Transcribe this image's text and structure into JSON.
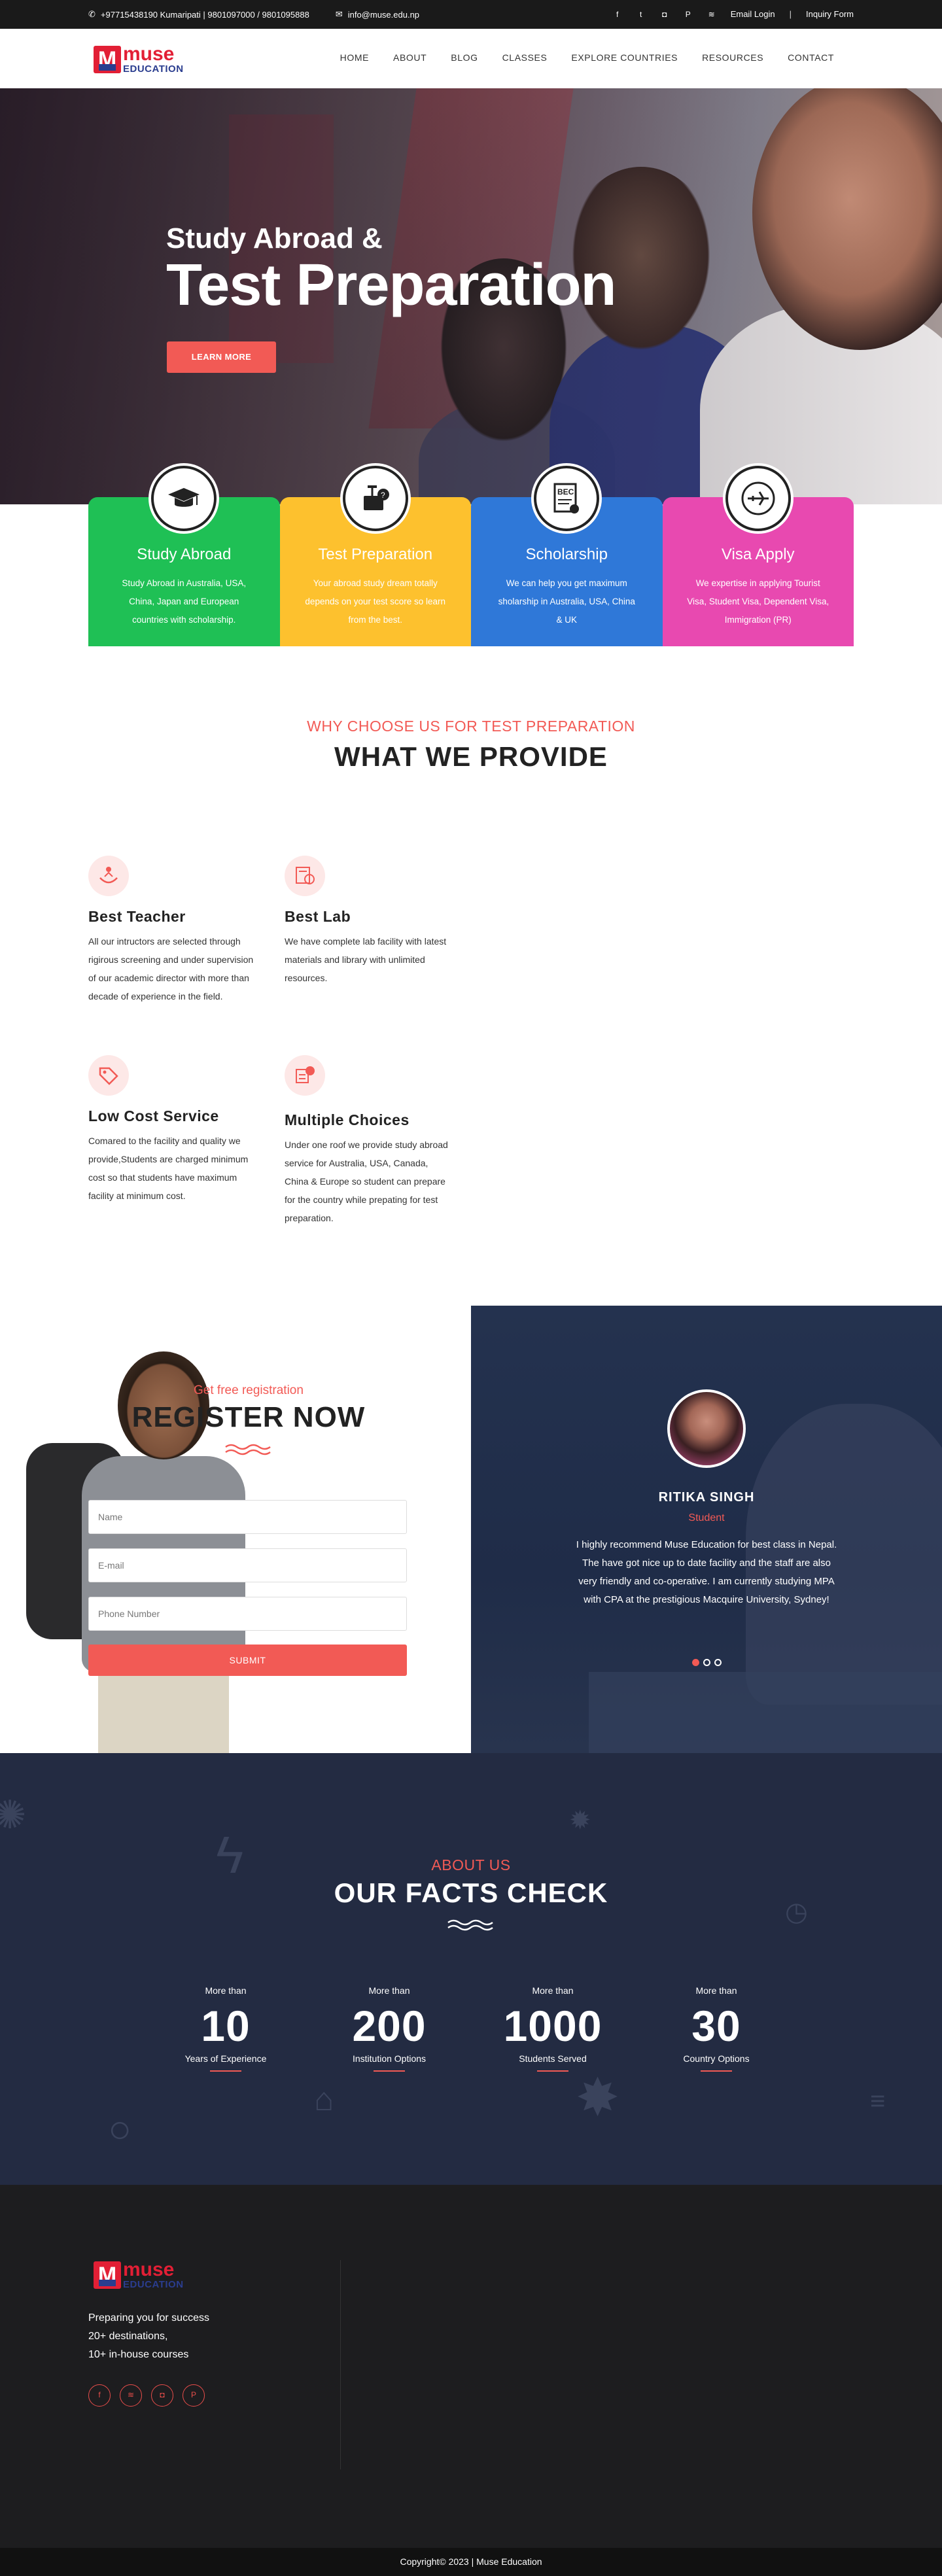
{
  "topbar": {
    "phone": "+97715438190 Kumaripati | 9801097000 / 9801095888",
    "email": "info@muse.edu.np",
    "social_icons": [
      "facebook-icon",
      "twitter-icon",
      "instagram-icon",
      "pinterest-icon",
      "rss-icon"
    ],
    "links": [
      "Email Login",
      "|",
      "Inquiry Form"
    ]
  },
  "logo": {
    "brand": "muse",
    "tagline": "EDUCATION"
  },
  "nav": [
    "HOME",
    "ABOUT",
    "BLOG",
    "CLASSES",
    "EXPLORE COUNTRIES",
    "RESOURCES",
    "CONTACT"
  ],
  "hero": {
    "line1": "Study Abroad &",
    "line2": "Test Preparation",
    "button": "LEARN MORE"
  },
  "services": [
    {
      "title": "Study Abroad",
      "text": "Study Abroad in Australia, USA, China, Japan and European countries with scholarship.",
      "color": "#1fc055",
      "icon": "graduation-cap-icon"
    },
    {
      "title": "Test Preparation",
      "text": "Your abroad study dream totally depends on your test score so learn from the best.",
      "color": "#fdc12e",
      "icon": "test-prep-icon"
    },
    {
      "title": "Scholarship",
      "text": "We can help you get maximum sholarship in Australia, USA, China & UK",
      "color": "#2f78d8",
      "icon": "certificate-icon"
    },
    {
      "title": "Visa Apply",
      "text": "We expertise in applying Tourist Visa, Student Visa, Dependent Visa, Immigration (PR)",
      "color": "#e849b0",
      "icon": "airplane-icon"
    }
  ],
  "why": {
    "subtitle": "WHY CHOOSE US FOR TEST PREPARATION",
    "title": "WHAT WE PROVIDE",
    "features": [
      {
        "title": "Best Teacher",
        "text": "All our intructors are selected through rigirous screening and under supervision of our academic director with more than decade of experience in the field.",
        "icon": "teacher-icon"
      },
      {
        "title": "Best Lab",
        "text": "We have complete lab facility with latest materials and library with unlimited resources.",
        "icon": "lab-icon"
      },
      {
        "title": "Low Cost Service",
        "text": "Comared to the facility and quality we provide,Students are charged minimum cost so that students have maximum facility at minimum cost.",
        "icon": "price-tag-icon"
      },
      {
        "title": "Multiple Choices",
        "text": "Under one roof we provide study abroad service for Australia, USA, Canada, China & Europe so student can prepare for the country while prepating for test preparation.",
        "icon": "choices-icon"
      }
    ]
  },
  "register": {
    "subtitle": "Get free registration",
    "title": "REGISTER NOW",
    "name_placeholder": "Name",
    "email_placeholder": "E-mail",
    "phone_placeholder": "Phone Number",
    "submit": "SUBMIT"
  },
  "testimonial": {
    "name": "RITIKA SINGH",
    "role": "Student",
    "quote": "I highly recommend Muse Education for best class in Nepal. The have got nice up to date facility and the staff are also very friendly and co-operative. I am currently studying MPA with CPA at the prestigious Macquire University, Sydney!"
  },
  "facts": {
    "subtitle": "ABOUT US",
    "title": "OUR FACTS CHECK",
    "stats": [
      {
        "prefix": "More than",
        "value": "10",
        "label": "Years of Experience"
      },
      {
        "prefix": "More than",
        "value": "200",
        "label": "Institution Options"
      },
      {
        "prefix": "More than",
        "value": "1000",
        "label": "Students Served"
      },
      {
        "prefix": "More than",
        "value": "30",
        "label": "Country Options"
      }
    ]
  },
  "footer": {
    "line1": "Preparing you for success",
    "line2": "20+ destinations,",
    "line3": "10+ in-house courses",
    "social_icons": [
      "facebook-icon",
      "rss-icon",
      "instagram-icon",
      "pinterest-icon"
    ],
    "copyright": "Copyright© 2023 | Muse Education"
  }
}
